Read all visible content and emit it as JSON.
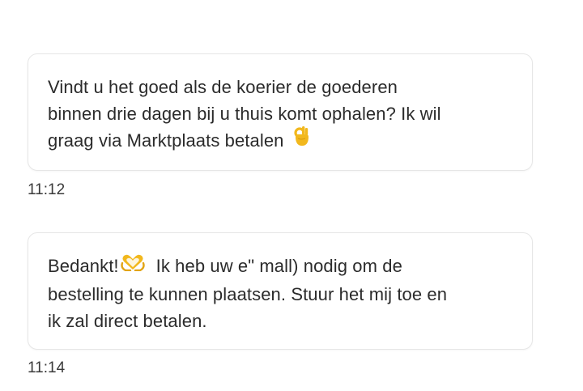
{
  "messages": [
    {
      "lines": [
        "Vindt u het goed als de koerier de goederen",
        "binnen drie dagen bij u thuis komt ophalen? Ik wil",
        "graag via Marktplaats betalen"
      ],
      "emoji": "ok-hand-emoji",
      "time": "11:12"
    },
    {
      "line1_before": "Bedankt!",
      "emoji": "heart-hands-emoji",
      "line1_after": "Ik heb uw e\" mall)  nodig om de",
      "lines": [
        "bestelling te kunnen plaatsen. Stuur het mij toe en",
        "ik zal direct betalen."
      ],
      "time": "11:14"
    }
  ],
  "colors": {
    "text": "#2b2b2b",
    "bubble_border": "#e6e6e6",
    "emoji_yellow": "#f2b81d"
  }
}
